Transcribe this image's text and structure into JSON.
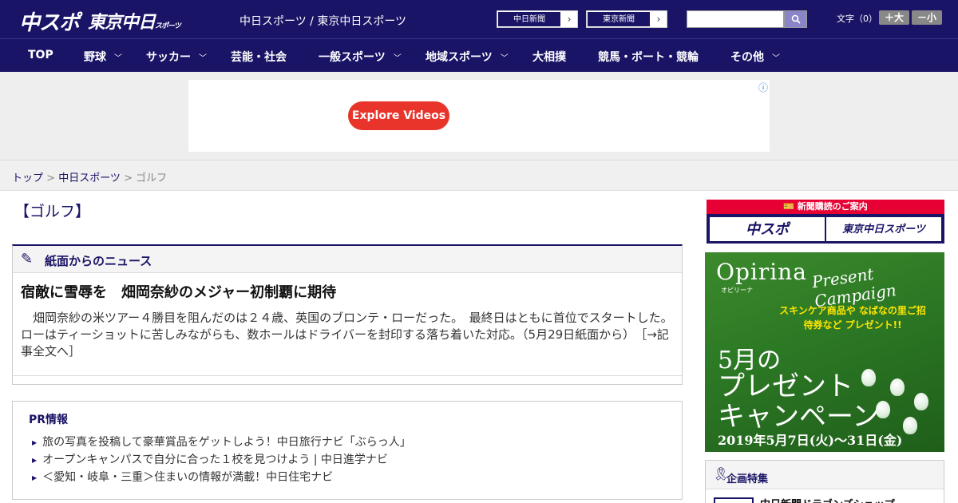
{
  "header": {
    "logo_chuspo": "中スポ",
    "logo_tokyo": "東京中日",
    "logo_tokyo_sub": "スポーツ",
    "site_title": "中日スポーツ / 東京中日スポーツ",
    "link_chunichi": "中日新聞",
    "link_tokyo": "東京新聞",
    "search_placeholder": "",
    "search_icon": "magnifier-icon",
    "text_size_label": "文字（0）",
    "size_larger": "＋大",
    "size_smaller": "－小"
  },
  "nav": [
    {
      "label": "TOP",
      "has_menu": false
    },
    {
      "label": "野球",
      "has_menu": true
    },
    {
      "label": "サッカー",
      "has_menu": true
    },
    {
      "label": "芸能・社会",
      "has_menu": false
    },
    {
      "label": "一般スポーツ",
      "has_menu": true
    },
    {
      "label": "地域スポーツ",
      "has_menu": true
    },
    {
      "label": "大相撲",
      "has_menu": false
    },
    {
      "label": "競馬・ボート・競輪",
      "has_menu": false
    },
    {
      "label": "その他",
      "has_menu": true
    }
  ],
  "ad": {
    "button_label": "Explore Videos",
    "button_color": "#e8342b"
  },
  "breadcrumb": {
    "home": "トップ",
    "sep1": " > ",
    "section": "中日スポーツ",
    "sep2": " > ",
    "current": "ゴルフ"
  },
  "page": {
    "heading": "【ゴルフ】"
  },
  "news_panel": {
    "title": "紙面からのニュース",
    "article_title": "宿敵に雪辱を　畑岡奈紗のメジャー初制覇に期待",
    "article_body": "　畑岡奈紗の米ツアー４勝目を阻んだのは２４歳、英国のブロンテ・ローだった。　最終日はともに首位でスタートした。ローはティーショットに苦しみながらも、数ホールはドライバーを封印する落ち着いた対応。（5月29日紙面から）",
    "read_more": "［→記事全文へ］"
  },
  "pr": {
    "title": "PR情報",
    "items": [
      "旅の写真を投稿して豪華賞品をゲットしよう！中日旅行ナビ「ぶらっ人」",
      "オープンキャンパスで自分に合った１校を見つけよう | 中日進学ナビ",
      "＜愛知・岐阜・三重＞住まいの情報が満載！中日住宅ナビ"
    ]
  },
  "sidebar": {
    "subscribe_bar": "新聞購読のご案内",
    "subscribe_chuspo": "中スポ",
    "subscribe_tokyo": "東京中日スポーツ",
    "promo": {
      "brand": "Opirina",
      "brand_sub": "オピリーナ",
      "script": "Present Campaign",
      "yellow_text": "スキンケア商品や なばなの里ご招待券など プレゼント!!",
      "line1": "5月の",
      "line2": "プレゼント",
      "line3": "キャンペーン",
      "dates": "2019年5月7日(火)〜31日(金)"
    },
    "feature_title": "企画特集",
    "feature_item": "中日新聞ドラゴンズショップ"
  },
  "colors": {
    "brand_navy": "#1a1466",
    "subscribe_red": "#e60033",
    "promo_yellow": "#ffe600"
  }
}
